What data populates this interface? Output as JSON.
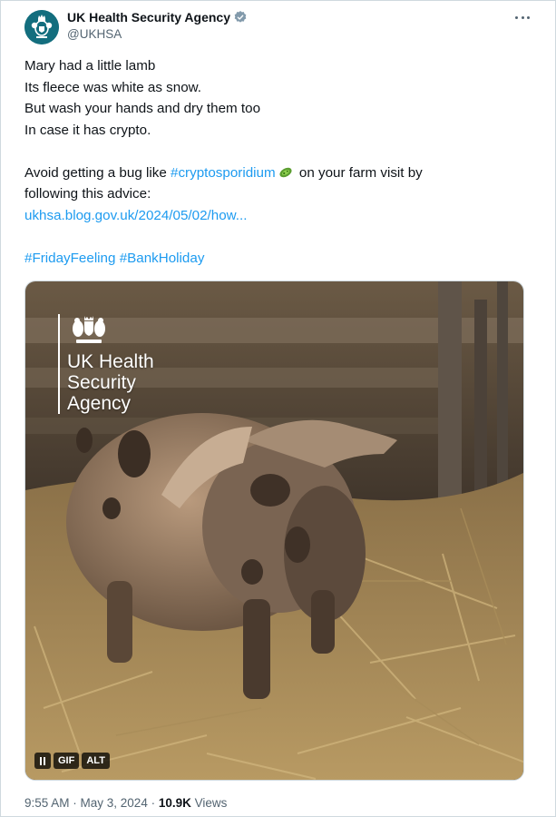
{
  "author": {
    "display_name": "UK Health Security Agency",
    "handle": "@UKHSA",
    "avatar": "ukhsa-crest-avatar",
    "verified_icon": "verified-badge-icon",
    "more_icon": "more-options-icon"
  },
  "tweet": {
    "lines": [
      "Mary had a little lamb",
      "Its fleece was white as snow.",
      "But wash your hands and dry them too",
      "In case it has crypto."
    ],
    "advice_prefix": "Avoid getting a bug like ",
    "advice_tag": "#cryptosporidium",
    "advice_suffix": " on your farm visit by",
    "advice_line2": "following this advice:",
    "link": "ukhsa.blog.gov.uk/2024/05/02/how...",
    "hashtags": [
      "#FridayFeeling",
      "#BankHoliday"
    ],
    "emoji": "microbe-icon"
  },
  "media": {
    "logo_lines": [
      "UK Health",
      "Security",
      "Agency"
    ],
    "controls": {
      "pause_icon": "pause-icon",
      "gif_label": "GIF",
      "alt_label": "ALT"
    }
  },
  "footer": {
    "time": "9:55 AM",
    "sep1": " · ",
    "date": "May 3, 2024",
    "sep2": " · ",
    "views_count": "10.9K",
    "views_label": " Views"
  },
  "colors": {
    "link": "#1d9bf0",
    "text": "#0f1419",
    "secondary": "#536471",
    "avatar_bg": "#136e7e",
    "verified": "#829aab"
  }
}
